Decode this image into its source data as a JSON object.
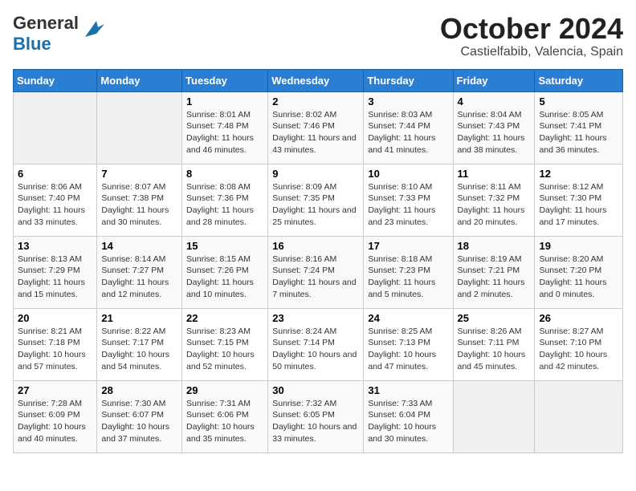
{
  "header": {
    "logo_general": "General",
    "logo_blue": "Blue",
    "title": "October 2024",
    "subtitle": "Castielfabib, Valencia, Spain"
  },
  "calendar": {
    "days_of_week": [
      "Sunday",
      "Monday",
      "Tuesday",
      "Wednesday",
      "Thursday",
      "Friday",
      "Saturday"
    ],
    "weeks": [
      [
        {
          "day": "",
          "info": ""
        },
        {
          "day": "",
          "info": ""
        },
        {
          "day": "1",
          "info": "Sunrise: 8:01 AM\nSunset: 7:48 PM\nDaylight: 11 hours and 46 minutes."
        },
        {
          "day": "2",
          "info": "Sunrise: 8:02 AM\nSunset: 7:46 PM\nDaylight: 11 hours and 43 minutes."
        },
        {
          "day": "3",
          "info": "Sunrise: 8:03 AM\nSunset: 7:44 PM\nDaylight: 11 hours and 41 minutes."
        },
        {
          "day": "4",
          "info": "Sunrise: 8:04 AM\nSunset: 7:43 PM\nDaylight: 11 hours and 38 minutes."
        },
        {
          "day": "5",
          "info": "Sunrise: 8:05 AM\nSunset: 7:41 PM\nDaylight: 11 hours and 36 minutes."
        }
      ],
      [
        {
          "day": "6",
          "info": "Sunrise: 8:06 AM\nSunset: 7:40 PM\nDaylight: 11 hours and 33 minutes."
        },
        {
          "day": "7",
          "info": "Sunrise: 8:07 AM\nSunset: 7:38 PM\nDaylight: 11 hours and 30 minutes."
        },
        {
          "day": "8",
          "info": "Sunrise: 8:08 AM\nSunset: 7:36 PM\nDaylight: 11 hours and 28 minutes."
        },
        {
          "day": "9",
          "info": "Sunrise: 8:09 AM\nSunset: 7:35 PM\nDaylight: 11 hours and 25 minutes."
        },
        {
          "day": "10",
          "info": "Sunrise: 8:10 AM\nSunset: 7:33 PM\nDaylight: 11 hours and 23 minutes."
        },
        {
          "day": "11",
          "info": "Sunrise: 8:11 AM\nSunset: 7:32 PM\nDaylight: 11 hours and 20 minutes."
        },
        {
          "day": "12",
          "info": "Sunrise: 8:12 AM\nSunset: 7:30 PM\nDaylight: 11 hours and 17 minutes."
        }
      ],
      [
        {
          "day": "13",
          "info": "Sunrise: 8:13 AM\nSunset: 7:29 PM\nDaylight: 11 hours and 15 minutes."
        },
        {
          "day": "14",
          "info": "Sunrise: 8:14 AM\nSunset: 7:27 PM\nDaylight: 11 hours and 12 minutes."
        },
        {
          "day": "15",
          "info": "Sunrise: 8:15 AM\nSunset: 7:26 PM\nDaylight: 11 hours and 10 minutes."
        },
        {
          "day": "16",
          "info": "Sunrise: 8:16 AM\nSunset: 7:24 PM\nDaylight: 11 hours and 7 minutes."
        },
        {
          "day": "17",
          "info": "Sunrise: 8:18 AM\nSunset: 7:23 PM\nDaylight: 11 hours and 5 minutes."
        },
        {
          "day": "18",
          "info": "Sunrise: 8:19 AM\nSunset: 7:21 PM\nDaylight: 11 hours and 2 minutes."
        },
        {
          "day": "19",
          "info": "Sunrise: 8:20 AM\nSunset: 7:20 PM\nDaylight: 11 hours and 0 minutes."
        }
      ],
      [
        {
          "day": "20",
          "info": "Sunrise: 8:21 AM\nSunset: 7:18 PM\nDaylight: 10 hours and 57 minutes."
        },
        {
          "day": "21",
          "info": "Sunrise: 8:22 AM\nSunset: 7:17 PM\nDaylight: 10 hours and 54 minutes."
        },
        {
          "day": "22",
          "info": "Sunrise: 8:23 AM\nSunset: 7:15 PM\nDaylight: 10 hours and 52 minutes."
        },
        {
          "day": "23",
          "info": "Sunrise: 8:24 AM\nSunset: 7:14 PM\nDaylight: 10 hours and 50 minutes."
        },
        {
          "day": "24",
          "info": "Sunrise: 8:25 AM\nSunset: 7:13 PM\nDaylight: 10 hours and 47 minutes."
        },
        {
          "day": "25",
          "info": "Sunrise: 8:26 AM\nSunset: 7:11 PM\nDaylight: 10 hours and 45 minutes."
        },
        {
          "day": "26",
          "info": "Sunrise: 8:27 AM\nSunset: 7:10 PM\nDaylight: 10 hours and 42 minutes."
        }
      ],
      [
        {
          "day": "27",
          "info": "Sunrise: 7:28 AM\nSunset: 6:09 PM\nDaylight: 10 hours and 40 minutes."
        },
        {
          "day": "28",
          "info": "Sunrise: 7:30 AM\nSunset: 6:07 PM\nDaylight: 10 hours and 37 minutes."
        },
        {
          "day": "29",
          "info": "Sunrise: 7:31 AM\nSunset: 6:06 PM\nDaylight: 10 hours and 35 minutes."
        },
        {
          "day": "30",
          "info": "Sunrise: 7:32 AM\nSunset: 6:05 PM\nDaylight: 10 hours and 33 minutes."
        },
        {
          "day": "31",
          "info": "Sunrise: 7:33 AM\nSunset: 6:04 PM\nDaylight: 10 hours and 30 minutes."
        },
        {
          "day": "",
          "info": ""
        },
        {
          "day": "",
          "info": ""
        }
      ]
    ]
  }
}
